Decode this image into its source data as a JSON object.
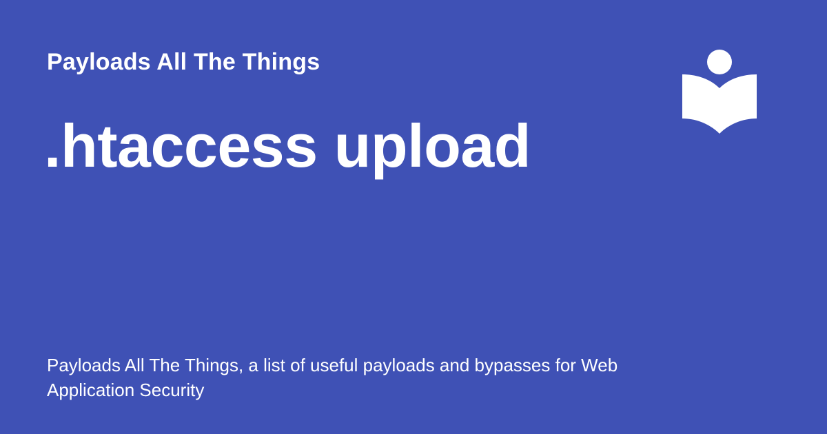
{
  "header": {
    "site_name": "Payloads All The Things"
  },
  "main": {
    "title": ".htaccess upload"
  },
  "footer": {
    "description": "Payloads All The Things, a list of useful payloads and bypasses for Web Application Security"
  },
  "logo": {
    "icon": "reader-book-icon"
  },
  "colors": {
    "background": "#3f51b5",
    "text": "#ffffff"
  }
}
